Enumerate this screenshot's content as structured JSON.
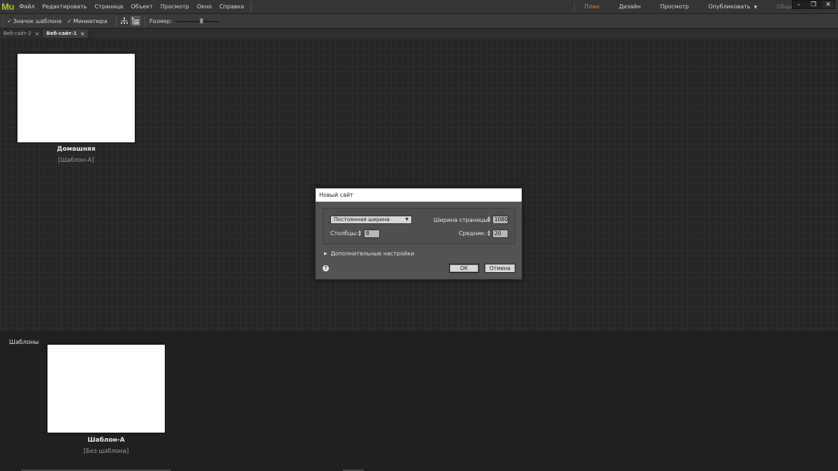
{
  "app": {
    "logo": "Mu",
    "menu": [
      "Файл",
      "Редактировать",
      "Страница",
      "Объект",
      "Просмотр",
      "Окно",
      "Справка"
    ],
    "modes": [
      {
        "label": "План",
        "state": "active"
      },
      {
        "label": "Дизайн",
        "state": "normal"
      },
      {
        "label": "Просмотр",
        "state": "normal"
      },
      {
        "label": "Опубликовать",
        "state": "normal",
        "dropdown": true
      },
      {
        "label": "Общий доступ",
        "state": "disabled"
      }
    ],
    "window_controls": {
      "minimize": "–",
      "restore": "❐",
      "close": "✕"
    },
    "accent_color": "#e8822a",
    "logo_color": "#a6c43a"
  },
  "toolbar": {
    "template_icon_label": "Значок шаблона",
    "template_icon_checked": true,
    "thumbnail_label": "Миниатюра",
    "thumbnail_checked": true,
    "size_label": "Размер:",
    "size_slider_fraction": 0.6
  },
  "doc_tabs": [
    {
      "label": "Веб-сайт-2",
      "active": false,
      "close": "×"
    },
    {
      "label": "Веб-сайт-1",
      "active": true,
      "close": "×"
    }
  ],
  "pages": {
    "home_title": "Домашняя",
    "home_template": "[Шаблон-А]"
  },
  "templates": {
    "section_label": "Шаблоны",
    "template_title": "Шаблон-А",
    "template_sub": "[Без шаблона]"
  },
  "dialog": {
    "title": "Новый сайт",
    "layout_select": "Постоянная ширина",
    "page_width_label": "Ширина страницы:",
    "page_width_value": "1080",
    "columns_label": "Столбцы:",
    "columns_value": "8",
    "gutter_label": "Средник:",
    "gutter_value": "20",
    "advanced_label": "Дополнительные настройки",
    "help": "?",
    "ok_label": "ОК",
    "cancel_label": "Отмена"
  }
}
